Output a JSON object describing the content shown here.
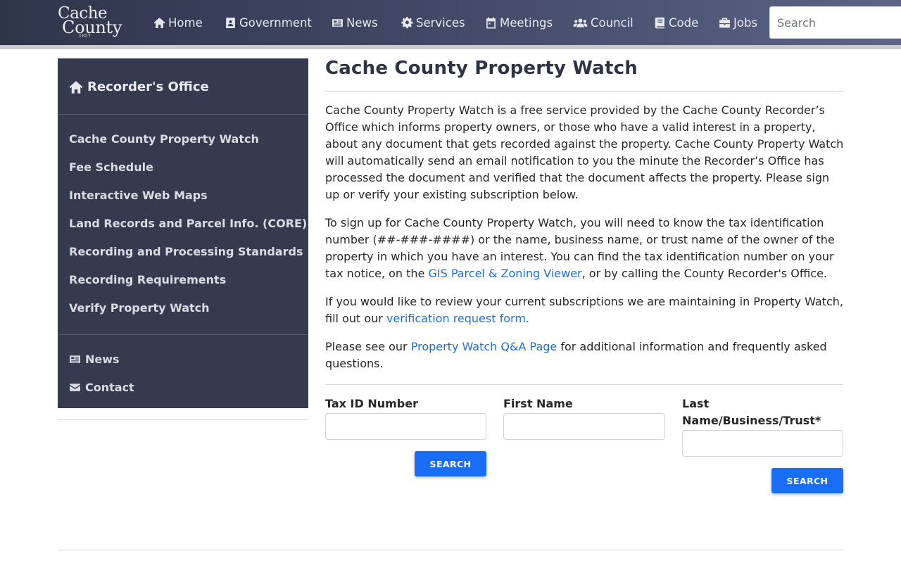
{
  "header": {
    "logo": {
      "line1": "Cache",
      "line2": "County",
      "line3": "1857"
    },
    "nav": [
      {
        "label": "Home",
        "icon": "home-icon"
      },
      {
        "label": "Government",
        "icon": "address-book-icon"
      },
      {
        "label": "News",
        "icon": "newspaper-icon"
      },
      {
        "label": "Services",
        "icon": "gear-icon"
      },
      {
        "label": "Meetings",
        "icon": "calendar-icon"
      },
      {
        "label": "Council",
        "icon": "users-icon"
      },
      {
        "label": "Code",
        "icon": "book-icon"
      },
      {
        "label": "Jobs",
        "icon": "briefcase-icon"
      }
    ],
    "search_placeholder": "Search"
  },
  "sidebar": {
    "heading": "Recorder's Office",
    "heading_icon": "home-icon",
    "links": [
      "Cache County Property Watch",
      "Fee Schedule",
      "Interactive Web Maps",
      "Land Records and Parcel Info. (CORE)",
      "Recording and Processing Standards",
      "Recording Requirements",
      "Verify Property Watch"
    ],
    "secondary": [
      {
        "label": "News",
        "icon": "newspaper-icon"
      },
      {
        "label": "Contact",
        "icon": "envelope-icon"
      }
    ]
  },
  "main": {
    "title": "Cache County Property Watch",
    "p1": "Cache County Property Watch is a free service provided by the Cache County Recorder’s Office which informs property owners, or those who have a valid interest in a property, about any document that gets recorded against the property. Cache County Property Watch will automatically send an email notification to you the minute the Recorder’s Office has processed the document and verified that the document affects the property. Please sign up or verify your existing subscription below.",
    "p2_before": "To sign up for Cache County Property Watch, you will need to know the tax identification number (##-###-####) or the name, business name, or trust name of the owner of the property in which you have an interest. You can find the tax identification number on your tax notice, on the ",
    "p2_link": "GIS Parcel & Zoning Viewer",
    "p2_after": ", or by calling the County Recorder's Office.",
    "p3_before": "If you would like to review your current subscriptions we are maintaining in Property Watch, fill out our ",
    "p3_link": "verification request form.",
    "p4_before": "Please see our ",
    "p4_link": "Property Watch Q&A Page",
    "p4_after": " for additional information and frequently asked questions.",
    "form": {
      "tax_id_label": "Tax ID Number",
      "first_name_label": "First Name",
      "last_name_label_line1": "Last",
      "last_name_label_line2": "Name/Business/Trust*",
      "tax_id_value": "",
      "first_name_value": "",
      "last_name_value": "",
      "search_button_1": "SEARCH",
      "search_button_2": "SEARCH"
    }
  },
  "colors": {
    "navbar": "#3d4561",
    "sidebar": "#353a4f",
    "link": "#1a6fe0",
    "button": "#1a6ef5"
  }
}
